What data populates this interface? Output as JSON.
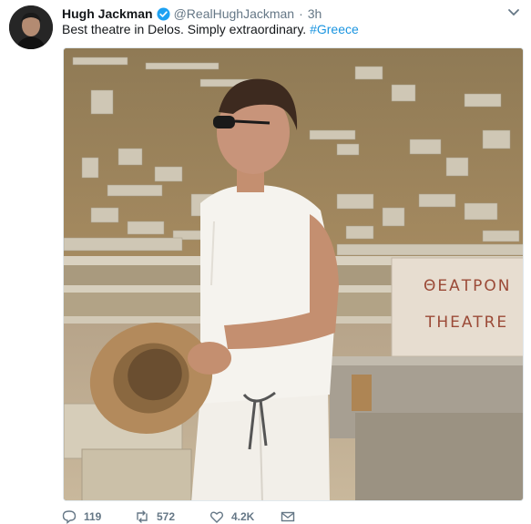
{
  "author": {
    "name": "Hugh Jackman",
    "handle": "@RealHughJackman",
    "separator": "·",
    "time": "3h"
  },
  "tweet": {
    "text": "Best theatre in Delos. Simply extraordinary.",
    "hashtag": "#Greece"
  },
  "photo": {
    "sign_line1": "ΘΕΑΤΡΟΝ",
    "sign_line2": "THEATRE"
  },
  "actions": {
    "replies": "119",
    "retweets": "572",
    "likes": "4.2K"
  },
  "colors": {
    "accent": "#1b95e0",
    "verified": "#1da1f2",
    "muted": "#657786"
  },
  "icons": {
    "verified": "verified-badge-icon",
    "menu": "chevron-down-icon",
    "reply": "reply-icon",
    "retweet": "retweet-icon",
    "like": "heart-icon",
    "dm": "envelope-icon"
  }
}
